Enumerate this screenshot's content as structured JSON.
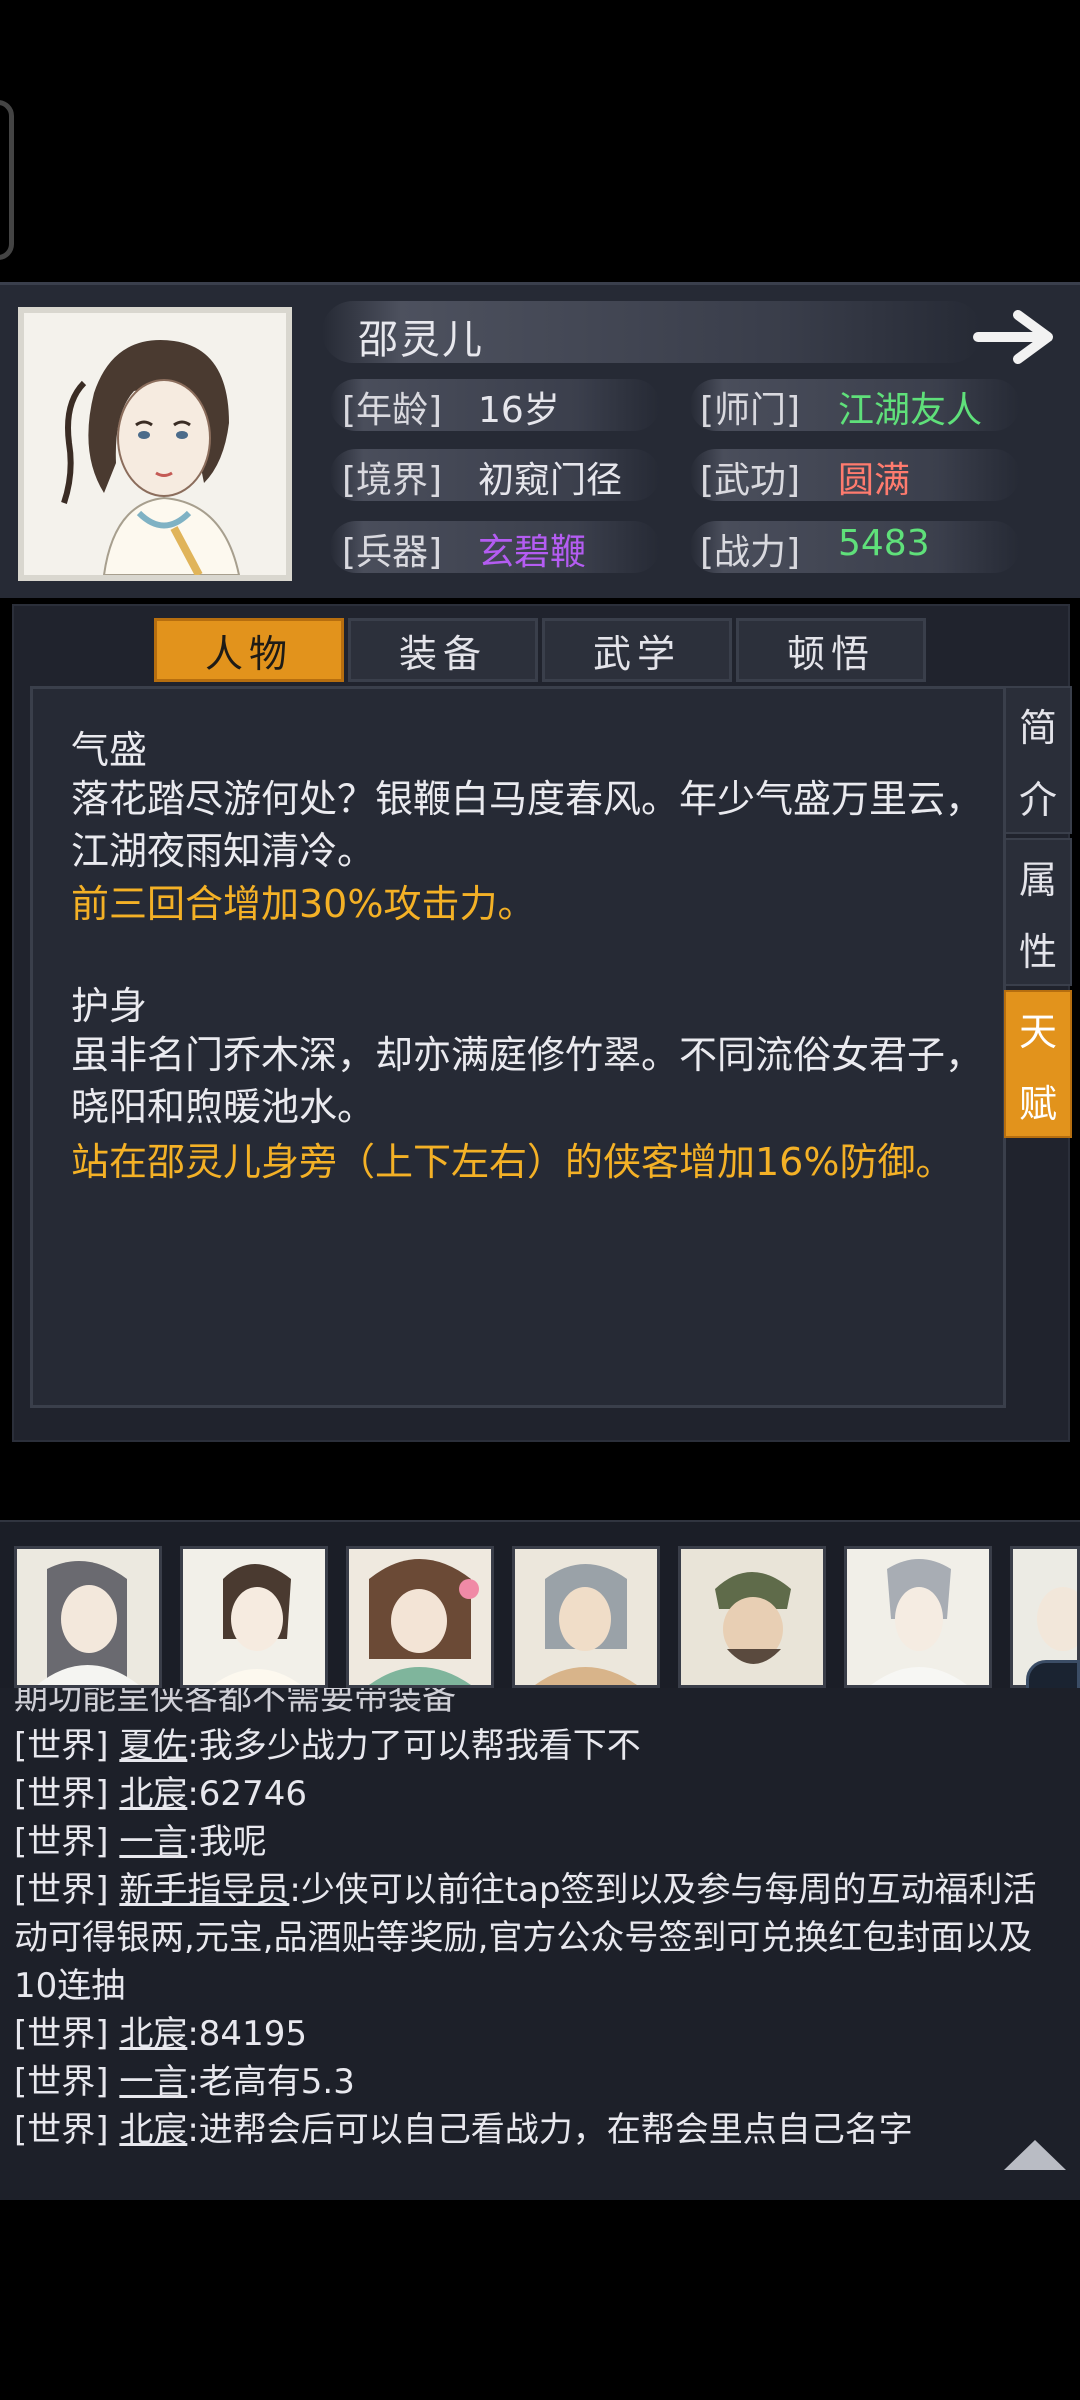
{
  "character": {
    "name": "邵灵儿",
    "stats": [
      {
        "label": "[年龄]",
        "value": "16岁",
        "color": "#e6e6ec"
      },
      {
        "label": "[师门]",
        "value": "江湖友人",
        "color": "#5fe07a"
      },
      {
        "label": "[境界]",
        "value": "初窥门径",
        "color": "#e6e6ec"
      },
      {
        "label": "[武功]",
        "value": "圆满",
        "color": "#ff7b6e"
      },
      {
        "label": "[兵器]",
        "value": "玄碧鞭",
        "color": "#b45cf2"
      },
      {
        "label": "[战力]",
        "value": "5483",
        "color": "#5fe07a"
      }
    ]
  },
  "tabs": [
    {
      "label": "人物",
      "active": true
    },
    {
      "label": "装备",
      "active": false
    },
    {
      "label": "武学",
      "active": false
    },
    {
      "label": "顿悟",
      "active": false
    }
  ],
  "side_tabs": [
    {
      "chars": [
        "简",
        "介"
      ],
      "active": false
    },
    {
      "chars": [
        "属",
        "性"
      ],
      "active": false
    },
    {
      "chars": [
        "天",
        "赋"
      ],
      "active": true
    }
  ],
  "talents": [
    {
      "title": "气盛",
      "desc": "落花踏尽游何处？银鞭白马度春风。年少气盛万里云，江湖夜雨知清冷。",
      "effect": "前三回合增加30%攻击力。"
    },
    {
      "title": "护身",
      "desc": "虽非名门乔木深，却亦满庭修竹翠。不同流俗女君子，晓阳和煦暖池水。",
      "effect": "站在邵灵儿身旁（上下左右）的侠客增加16%防御。"
    }
  ],
  "chat": {
    "partial_line": "期功能呈侠客都不需要带装备",
    "messages": [
      {
        "channel": "[世界]",
        "user": "夏佐",
        "text": ":我多少战力了可以帮我看下不"
      },
      {
        "channel": "[世界]",
        "user": "北宸",
        "text": ":62746"
      },
      {
        "channel": "[世界]",
        "user": "一言",
        "text": ":我呢"
      },
      {
        "channel": "[世界]",
        "user": "新手指导员",
        "text": ":少侠可以前往tap签到以及参与每周的互动福利活动可得银两,元宝,品酒贴等奖励,官方公众号签到可兑换红包封面以及10连抽"
      },
      {
        "channel": "[世界]",
        "user": "北宸",
        "text": ":84195"
      },
      {
        "channel": "[世界]",
        "user": "一言",
        "text": ":老高有5.3"
      },
      {
        "channel": "[世界]",
        "user": "北宸",
        "text": ":进帮会后可以自己看战力，在帮会里点自己名字"
      }
    ]
  },
  "icons": {
    "next": "right-arrow-icon",
    "scroll": "triangle-up-icon"
  },
  "colors": {
    "accent": "#e2931c",
    "effect_text": "#f4b126",
    "panel": "#262a35"
  }
}
